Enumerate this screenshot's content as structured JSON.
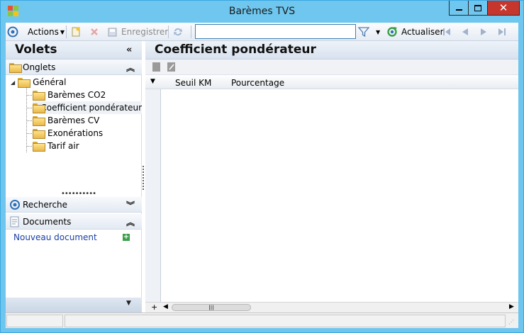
{
  "window": {
    "title": "Barèmes TVS"
  },
  "toolbar": {
    "actions_label": "Actions",
    "save_label": "Enregistrer",
    "search_value": "",
    "refresh_label": "Actualiser"
  },
  "left_panel": {
    "title": "Volets",
    "sections": [
      {
        "label": "Onglets",
        "icon": "folder-icon",
        "state": "expanded"
      },
      {
        "label": "Recherche",
        "icon": "target-icon",
        "state": "collapsed"
      },
      {
        "label": "Documents",
        "icon": "document-icon",
        "state": "expanded"
      }
    ],
    "tree": {
      "root": "Général",
      "children": [
        "Barèmes CO2",
        "Coefficient pondérateur",
        "Barèmes CV",
        "Exonérations",
        "Tarif air"
      ],
      "selected": "Coefficient pondérateur"
    },
    "documents": {
      "new_document_label": "Nouveau document"
    }
  },
  "main": {
    "title": "Coefficient pondérateur",
    "grid": {
      "columns": [
        "Seuil KM",
        "Pourcentage"
      ],
      "rows": []
    }
  },
  "colors": {
    "title_bar": "#6fc7ef",
    "close_button": "#c6362c",
    "link_text": "#1a3fa6",
    "accent_blue": "#2e6fb5"
  }
}
